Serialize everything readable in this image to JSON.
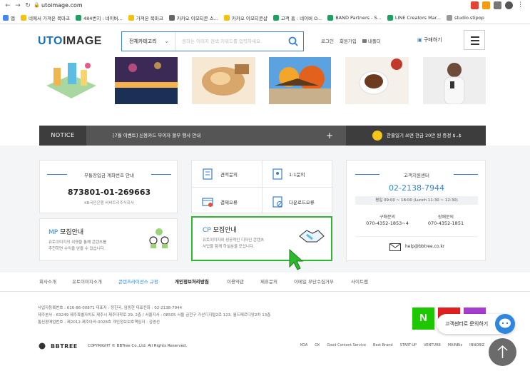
{
  "browser": {
    "url": "utoimage.com",
    "bookmarks": [
      {
        "label": "앱",
        "color": "#4285f4"
      },
      {
        "label": "네에서 가져온 북마크",
        "color": "#f4c20d"
      },
      {
        "label": "484번지 : 네이버...",
        "color": "#1aa260"
      },
      {
        "label": "가져온 북마크",
        "color": "#f4c20d"
      },
      {
        "label": "카카오 이모티콘 스...",
        "color": "#666666"
      },
      {
        "label": "카카오 이모티콘샵",
        "color": "#f4c20d"
      },
      {
        "label": "고객 홈 : 네이버 O...",
        "color": "#1aa260"
      },
      {
        "label": "BAND Partners - S...",
        "color": "#1aa260"
      },
      {
        "label": "LINE Creators Mar...",
        "color": "#1aa260"
      },
      {
        "label": "studio.stipop",
        "color": "#999999"
      }
    ]
  },
  "header": {
    "logo_part1": "UTO",
    "logo_part2": "IMAGE",
    "search_category": "전체카테고리",
    "search_placeholder": "원하는 이미지 검색 키워드를 입력하세요",
    "links": [
      "로그인",
      "회원가입",
      "내폴더"
    ],
    "buy_label": "구매하기"
  },
  "notice": {
    "label": "NOTICE",
    "text": "[7월 이벤트] 신용카드 무이자 할부 행사 안내",
    "promo": "한줄일기 쓰면 현금 20만 원 증정 $..$"
  },
  "account_card": {
    "title": "무통장입금 계좌번호 안내",
    "number": "873801-01-269663",
    "bank": "KB국민은행 비비트리주식회사"
  },
  "mp_card": {
    "prefix": "MP",
    "title": " 모집안내",
    "line1": "유토이미지의 위젯을 통해 콘텐츠를",
    "line2": "추천하면 수익을 얻을 수 있습니다."
  },
  "service_grid": {
    "items": [
      "견적문의",
      "1:1문의",
      "결제오류",
      "다운로드오류"
    ]
  },
  "cp_card": {
    "prefix": "CP",
    "title": " 모집안내",
    "line1": "유토이미지와 성공적인 디자인 콘텐츠",
    "line2": "사업을 함께 하실분을 모십니다."
  },
  "support": {
    "title": "고객지원센터",
    "phone": "02-2138-7944",
    "hours": "평일 09:00 ~ 18:00 (Lunch 11:30 ~ 12:30)",
    "buy_label": "구매문의",
    "buy_phone": "070-4352-1853~4",
    "error_label": "장애문의",
    "error_phone": "070-4352-1851",
    "email": "help@bbtree.co.kr"
  },
  "footer": {
    "links": [
      "회사소개",
      "유토이미지소개",
      "콘텐츠라이선스 규정",
      "개인정보처리방침",
      "이용약관",
      "제휴문의",
      "이메일 무단수집거부",
      "사이트맵"
    ],
    "info1": "사업자등록번호 : 616-86-00871 대표자 : 정헌국, 임동현 대표전화 : 02-2138-7944",
    "info2": "제주본사 : 63249 제주특별자치도 제주시 제주대학로 29, 2층 / 서울지사 : 08505 서울 금천구 가산디지털2로 123, 월드메르디앙2차 13층",
    "info3": "통신판매업번호 : 제2012-제주아라-0028호 개인정보보호책임자 : 김영선",
    "brand": "BBTREE",
    "copyright": "COPYRIGHT © BBTree Co.,Ltd. All Rights Reserved.",
    "certs": [
      "KOA",
      "OX",
      "Good Content Service",
      "Best Brand",
      "START-UP",
      "VENTURE",
      "MAINBiz",
      "INNOBIZ"
    ]
  },
  "chat": {
    "label": "고객센터로 문의하기"
  }
}
